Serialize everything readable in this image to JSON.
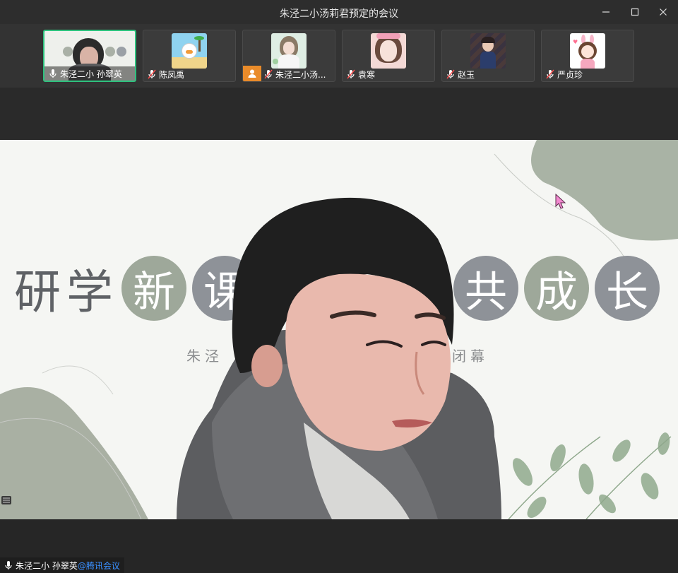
{
  "window": {
    "title": "朱泾二小汤莉君预定的会议",
    "controls": [
      "minimize-icon",
      "maximize-icon",
      "close-icon"
    ]
  },
  "participants": [
    {
      "name": "朱泾二小 孙翠英",
      "mic": "on",
      "active": true,
      "thumb": "presenter-video"
    },
    {
      "name": "陈凤禹",
      "mic": "muted",
      "active": false,
      "thumb": "cartoon-avatar"
    },
    {
      "name": "朱泾二小汤...",
      "mic": "muted",
      "active": false,
      "thumb": "illustration-avatar",
      "host_badge": true
    },
    {
      "name": "袁寒",
      "mic": "muted",
      "active": false,
      "thumb": "photo-avatar"
    },
    {
      "name": "赵玉",
      "mic": "muted",
      "active": false,
      "thumb": "child-photo-avatar"
    },
    {
      "name": "严贞珍",
      "mic": "muted",
      "active": false,
      "thumb": "bunny-girl-avatar"
    }
  ],
  "slide": {
    "chars": [
      {
        "c": "研",
        "style": "plain"
      },
      {
        "c": "学",
        "style": "plain"
      },
      {
        "c": "新",
        "style": "circle",
        "color": "#9ea89a"
      },
      {
        "c": "课",
        "style": "circle",
        "color": "#8e9298"
      },
      {
        "c": "共",
        "style": "circle",
        "color": "#8e9298"
      },
      {
        "c": "成",
        "style": "circle",
        "color": "#9ea89a"
      },
      {
        "c": "长",
        "style": "circle",
        "color": "#8e9298"
      }
    ],
    "subtitle_start": "朱泾",
    "subtitle_end": "闭幕"
  },
  "footer": {
    "speaker_name": "朱泾二小 孙翠英",
    "brand": "@腾讯会议"
  },
  "colors": {
    "active_border": "#2ec27e",
    "host_badge": "#e98b2a",
    "brand_blue": "#3a8fff"
  }
}
